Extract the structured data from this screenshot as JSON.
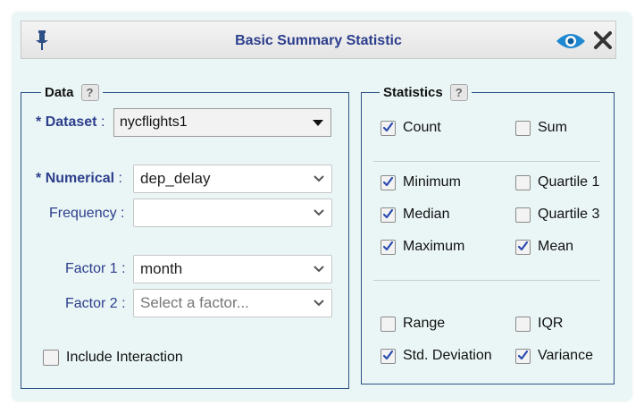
{
  "window": {
    "title": "Basic Summary Statistic",
    "icons": [
      "pin-icon",
      "eye-icon",
      "close-icon"
    ]
  },
  "data_panel": {
    "legend": "Data",
    "help": "?",
    "dataset": {
      "label": "Dataset",
      "required_mark": "*",
      "value": "nycflights1"
    },
    "numerical": {
      "label": "Numerical",
      "required_mark": "*",
      "value": "dep_delay"
    },
    "frequency": {
      "label": "Frequency",
      "value": ""
    },
    "factor1": {
      "label": "Factor 1",
      "value": "month"
    },
    "factor2": {
      "label": "Factor 2",
      "placeholder": "Select a factor..."
    },
    "include_interaction": {
      "label": "Include Interaction",
      "checked": false
    }
  },
  "stats_panel": {
    "legend": "Statistics",
    "help": "?",
    "items": {
      "count": {
        "label": "Count",
        "checked": true
      },
      "sum": {
        "label": "Sum",
        "checked": false
      },
      "minimum": {
        "label": "Minimum",
        "checked": true
      },
      "quartile1": {
        "label": "Quartile 1",
        "checked": false
      },
      "median": {
        "label": "Median",
        "checked": true
      },
      "quartile3": {
        "label": "Quartile 3",
        "checked": false
      },
      "maximum": {
        "label": "Maximum",
        "checked": true
      },
      "mean": {
        "label": "Mean",
        "checked": true
      },
      "range": {
        "label": "Range",
        "checked": false
      },
      "iqr": {
        "label": "IQR",
        "checked": false
      },
      "std_dev": {
        "label": "Std. Deviation",
        "checked": true
      },
      "variance": {
        "label": "Variance",
        "checked": true
      }
    }
  },
  "colors": {
    "accent": "#2d3e8c",
    "panel_bg": "#eaf6f6",
    "border": "#2d4f85",
    "eye": "#1e88d0"
  }
}
